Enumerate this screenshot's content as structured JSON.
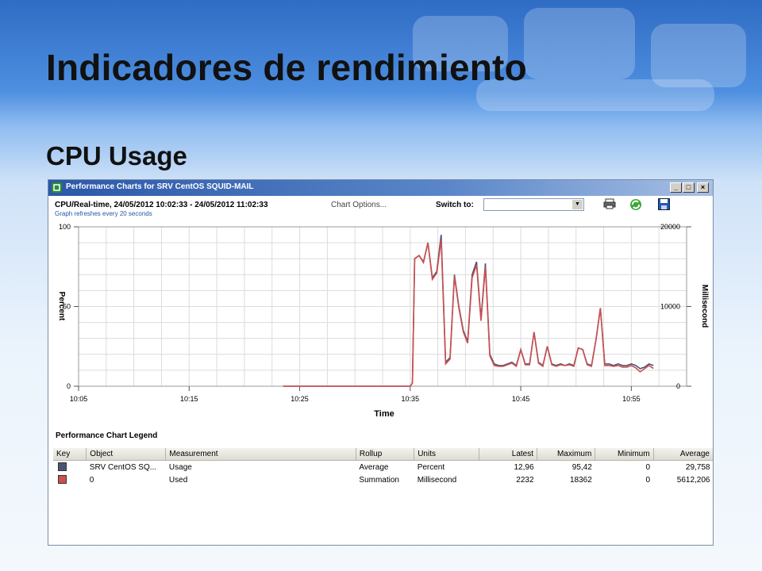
{
  "slide": {
    "title": "Indicadores de rendimiento",
    "subtitle": "CPU Usage"
  },
  "window": {
    "title": "Performance Charts for SRV CentOS SQUID-MAIL",
    "controls": [
      "_",
      "□",
      "×"
    ]
  },
  "header": {
    "info": "CPU/Real-time, 24/05/2012 10:02:33 - 24/05/2012 11:02:33",
    "chart_options": "Chart Options...",
    "refresh_note": "Graph refreshes every 20 seconds",
    "switch_label": "Switch to:",
    "switch_value": "",
    "icons": [
      "print-icon",
      "refresh-icon",
      "save-icon"
    ]
  },
  "colors": {
    "usage": "#4a5472",
    "used": "#cc5050",
    "titlebar": "#2b57a8"
  },
  "chart_data": {
    "type": "line",
    "xlabel": "Time",
    "ylabel_left": "Percent",
    "ylabel_right": "Millisecond",
    "y_left_ticks": [
      "100",
      "50",
      "0"
    ],
    "y_right_ticks": [
      "20000",
      "10000",
      "0"
    ],
    "ylim_left": [
      0,
      100
    ],
    "ylim_right": [
      0,
      20000
    ],
    "x_ticks": [
      "10:05",
      "10:15",
      "10:25",
      "10:35",
      "10:45",
      "10:55"
    ],
    "grid": true,
    "series": [
      {
        "name": "Usage",
        "axis": "left",
        "points": [
          [
            21.5,
            0
          ],
          [
            31,
            0
          ],
          [
            33,
            0
          ],
          [
            33.2,
            2
          ],
          [
            33.4,
            80
          ],
          [
            33.8,
            82
          ],
          [
            34.2,
            78
          ],
          [
            34.6,
            90
          ],
          [
            35,
            68
          ],
          [
            35.4,
            72
          ],
          [
            35.8,
            95
          ],
          [
            36.2,
            15
          ],
          [
            36.6,
            18
          ],
          [
            37,
            70
          ],
          [
            37.4,
            50
          ],
          [
            37.8,
            35
          ],
          [
            38.2,
            28
          ],
          [
            38.6,
            70
          ],
          [
            39,
            78
          ],
          [
            39.4,
            42
          ],
          [
            39.8,
            77
          ],
          [
            40.2,
            20
          ],
          [
            40.6,
            14
          ],
          [
            41,
            13
          ],
          [
            41.4,
            13
          ],
          [
            41.8,
            14
          ],
          [
            42.2,
            15
          ],
          [
            42.6,
            13
          ],
          [
            43,
            23
          ],
          [
            43.4,
            14
          ],
          [
            43.8,
            14
          ],
          [
            44.2,
            34
          ],
          [
            44.6,
            15
          ],
          [
            45,
            13
          ],
          [
            45.4,
            25
          ],
          [
            45.8,
            14
          ],
          [
            46.2,
            13
          ],
          [
            46.6,
            14
          ],
          [
            47,
            13
          ],
          [
            47.4,
            14
          ],
          [
            47.8,
            13
          ],
          [
            48.2,
            24
          ],
          [
            48.6,
            23
          ],
          [
            49,
            14
          ],
          [
            49.4,
            13
          ],
          [
            49.8,
            29
          ],
          [
            50.2,
            49
          ],
          [
            50.6,
            14
          ],
          [
            51,
            14
          ],
          [
            51.4,
            13
          ],
          [
            51.8,
            14
          ],
          [
            52.2,
            13
          ],
          [
            52.6,
            13
          ],
          [
            53,
            14
          ],
          [
            53.4,
            13
          ],
          [
            53.8,
            11
          ],
          [
            54.2,
            12
          ],
          [
            54.6,
            14
          ],
          [
            55,
            13
          ]
        ]
      },
      {
        "name": "Used",
        "axis": "right",
        "points": [
          [
            21.5,
            0
          ],
          [
            31,
            0
          ],
          [
            33,
            0
          ],
          [
            33.2,
            400
          ],
          [
            33.4,
            16000
          ],
          [
            33.8,
            16400
          ],
          [
            34.2,
            15500
          ],
          [
            34.6,
            18000
          ],
          [
            35,
            13400
          ],
          [
            35.4,
            14200
          ],
          [
            35.8,
            18362
          ],
          [
            36.2,
            2800
          ],
          [
            36.6,
            3400
          ],
          [
            37,
            13800
          ],
          [
            37.4,
            9800
          ],
          [
            37.8,
            6800
          ],
          [
            38.2,
            5400
          ],
          [
            38.6,
            13600
          ],
          [
            39,
            15200
          ],
          [
            39.4,
            8200
          ],
          [
            39.8,
            15000
          ],
          [
            40.2,
            3800
          ],
          [
            40.6,
            2600
          ],
          [
            41,
            2500
          ],
          [
            41.4,
            2500
          ],
          [
            41.8,
            2700
          ],
          [
            42.2,
            2900
          ],
          [
            42.6,
            2500
          ],
          [
            43,
            4600
          ],
          [
            43.4,
            2700
          ],
          [
            43.8,
            2700
          ],
          [
            44.2,
            6800
          ],
          [
            44.6,
            2900
          ],
          [
            45,
            2500
          ],
          [
            45.4,
            5000
          ],
          [
            45.8,
            2700
          ],
          [
            46.2,
            2500
          ],
          [
            46.6,
            2700
          ],
          [
            47,
            2600
          ],
          [
            47.4,
            2700
          ],
          [
            47.8,
            2500
          ],
          [
            48.2,
            4800
          ],
          [
            48.6,
            4600
          ],
          [
            49,
            2700
          ],
          [
            49.4,
            2500
          ],
          [
            49.8,
            5800
          ],
          [
            50.2,
            9800
          ],
          [
            50.6,
            2600
          ],
          [
            51,
            2600
          ],
          [
            51.4,
            2500
          ],
          [
            51.8,
            2600
          ],
          [
            52.2,
            2400
          ],
          [
            52.6,
            2400
          ],
          [
            53,
            2600
          ],
          [
            53.4,
            2300
          ],
          [
            53.8,
            1800
          ],
          [
            54.2,
            2200
          ],
          [
            54.6,
            2600
          ],
          [
            55,
            2232
          ]
        ]
      }
    ]
  },
  "legend": {
    "title": "Performance Chart Legend",
    "columns": [
      "Key",
      "Object",
      "Measurement",
      "Rollup",
      "Units",
      "Latest",
      "Maximum",
      "Minimum",
      "Average"
    ],
    "rows": [
      {
        "object": "SRV CentOS SQ...",
        "measurement": "Usage",
        "rollup": "Average",
        "units": "Percent",
        "latest": "12,96",
        "maximum": "95,42",
        "minimum": "0",
        "average": "29,758"
      },
      {
        "object": "0",
        "measurement": "Used",
        "rollup": "Summation",
        "units": "Millisecond",
        "latest": "2232",
        "maximum": "18362",
        "minimum": "0",
        "average": "5612,206"
      }
    ]
  }
}
